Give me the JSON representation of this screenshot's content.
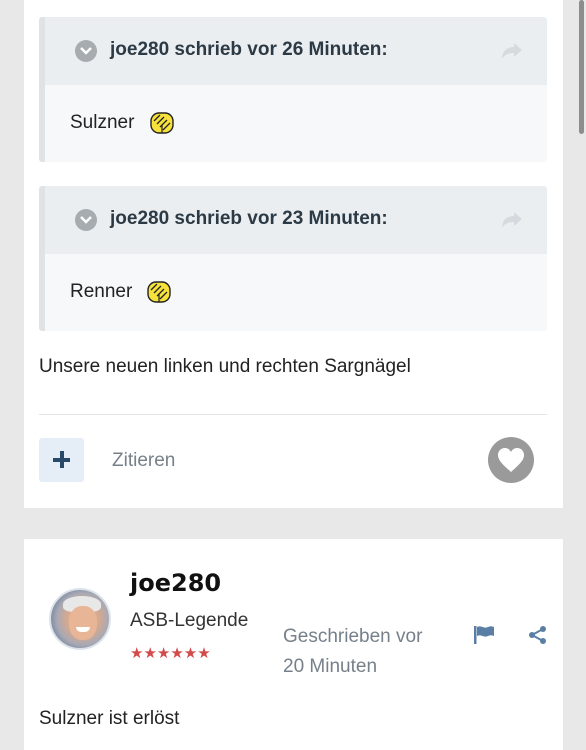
{
  "post": {
    "quotes": [
      {
        "header": "joe280 schrieb vor 26 Minuten:",
        "text": "Sulzner",
        "emoji_icon": "hands-praying-emoji"
      },
      {
        "header": "joe280 schrieb vor 23 Minuten:",
        "text": "Renner",
        "emoji_icon": "hands-praying-emoji"
      }
    ],
    "body": "Unsere neuen linken und rechten Sargnägel",
    "cite_label": "Zitieren"
  },
  "reply": {
    "username": "joe280",
    "rank": "ASB-Legende",
    "stars": "★★★★★★",
    "meta_line1": "Geschrieben vor",
    "meta_line2": "20 Minuten",
    "body": "Sulzner ist erlöst"
  },
  "colors": {
    "accent_blue": "#27496a",
    "star_red": "#d34a4a",
    "muted_text": "#76808a"
  }
}
